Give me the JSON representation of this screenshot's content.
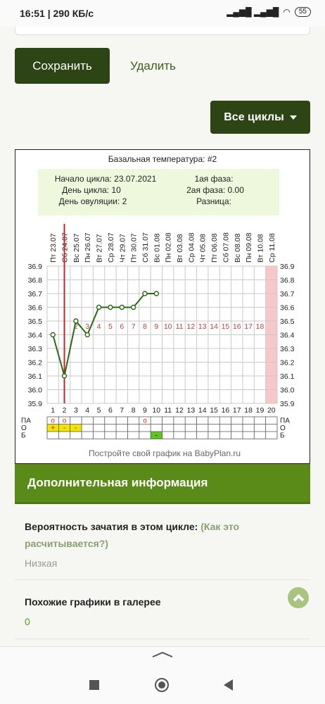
{
  "status": {
    "time": "16:51",
    "speed": "290 КБ/с",
    "signal": "signal-icons",
    "wifi": "wifi-icon",
    "battery": "55"
  },
  "actions": {
    "save_label": "Сохранить",
    "delete_label": "Удалить",
    "cycles_label": "Все циклы"
  },
  "chart_data": {
    "type": "line",
    "title": "Базальная температура: #2",
    "info": {
      "start": "Начало цикла: 23.07.2021",
      "day": "День цикла: 10",
      "ovulation": "День овуляции: 2",
      "phase1": "1ая фаза:",
      "phase2": "2ая фаза: 0.00",
      "diff": "Разница:"
    },
    "dates": [
      "Пт 23.07",
      "Сб 24.07",
      "Вс 25.07",
      "Пн 26.07",
      "Вт 27.07",
      "Ср 28.07",
      "Чт 29.07",
      "Пт 30.07",
      "Сб 31.07",
      "Вс 01.08",
      "Пн 02.08",
      "Вт 03.08",
      "Ср 04.08",
      "Чт 05.08",
      "Пт 06.08",
      "Сб 07.08",
      "Вс 08.08",
      "Пн 09.08",
      "Вт 10.08",
      "Ср 11.08"
    ],
    "days": [
      "1",
      "2",
      "3",
      "4",
      "5",
      "6",
      "7",
      "8",
      "9",
      "10",
      "11",
      "12",
      "13",
      "14",
      "15",
      "16",
      "17",
      "18",
      "19",
      "20"
    ],
    "y_ticks": [
      "36.9",
      "36.8",
      "36.7",
      "36.6",
      "36.5",
      "36.4",
      "36.3",
      "36.2",
      "36.1",
      "36.0",
      "35.9"
    ],
    "ylim": [
      35.9,
      36.9
    ],
    "temps": [
      36.4,
      36.1,
      36.5,
      36.4,
      36.6,
      36.6,
      36.6,
      36.6,
      36.7,
      36.7
    ],
    "phase_numbers": [
      "2",
      "3",
      "4",
      "5",
      "6",
      "7",
      "8",
      "9",
      "10",
      "11",
      "12",
      "13",
      "14",
      "15",
      "16",
      "17",
      "18"
    ],
    "ovulation_day": 2,
    "highlight_day": 20,
    "row_labels": [
      "ПА",
      "О",
      "Б"
    ],
    "pa_marks": [
      1,
      2,
      9
    ],
    "o_marks": [
      "+",
      "-",
      "-"
    ],
    "b_marks": [
      10
    ],
    "o_symbol": "o",
    "b_symbol": "-",
    "footer": "Постройте свой график на BabyPlan.ru",
    "colors": {
      "line": "#2a6a16",
      "ovulation": "#d42020",
      "phase_text": "#c44040",
      "highlight": "#f8c8c8",
      "info_bg": "#eef8dc",
      "o_fill": "#f2e600",
      "b_fill": "#5fc51a"
    }
  },
  "additional": {
    "header": "Дополнительная информация",
    "conception_label": "Вероятность зачатия в этом цикле:",
    "conception_link": "(Как это расчитывается?)",
    "conception_value": "Низкая",
    "similar_label": "Похожие графики в галерее",
    "similar_value": "0"
  }
}
